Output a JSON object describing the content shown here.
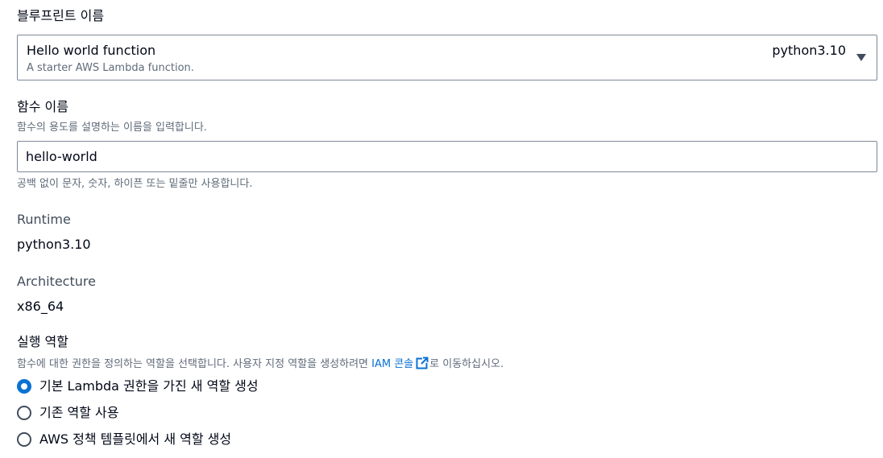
{
  "blueprint": {
    "label": "블루프린트 이름",
    "selected_title": "Hello world function",
    "selected_description": "A starter AWS Lambda function.",
    "selected_runtime_tag": "python3.10",
    "icon": "caret-down-icon"
  },
  "function_name": {
    "label": "함수 이름",
    "description": "함수의 용도를 설명하는 이름을 입력합니다.",
    "value": "hello-world",
    "constraint": "공백 없이 문자, 숫자, 하이픈 또는 밑줄만 사용합니다."
  },
  "runtime": {
    "label": "Runtime",
    "value": "python3.10"
  },
  "architecture": {
    "label": "Architecture",
    "value": "x86_64"
  },
  "execution_role": {
    "label": "실행 역할",
    "description_prefix": "함수에 대한 권한을 정의하는 역할을 선택합니다. 사용자 지정 역할을 생성하려면 ",
    "link_text": "IAM 콘솔",
    "link_icon": "external-link-icon",
    "description_suffix": "로 이동하십시오.",
    "options": [
      {
        "label": "기본 Lambda 권한을 가진 새 역할 생성",
        "selected": true
      },
      {
        "label": "기존 역할 사용",
        "selected": false
      },
      {
        "label": "AWS 정책 템플릿에서 새 역할 생성",
        "selected": false
      }
    ]
  },
  "colors": {
    "accent": "#0972d3",
    "border": "#7d8998",
    "secondary_text": "#5f6b7a"
  }
}
